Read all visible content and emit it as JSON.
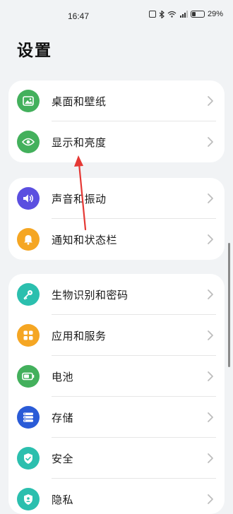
{
  "status_bar": {
    "time": "16:47",
    "battery": "29%"
  },
  "page": {
    "title": "设置"
  },
  "groups": [
    {
      "items": [
        {
          "label": "桌面和壁纸",
          "icon": "wallpaper-icon",
          "color": "#43b05c"
        },
        {
          "label": "显示和亮度",
          "icon": "eye-icon",
          "color": "#43b05c"
        }
      ]
    },
    {
      "items": [
        {
          "label": "声音和振动",
          "icon": "speaker-icon",
          "color": "#5b4fe0"
        },
        {
          "label": "通知和状态栏",
          "icon": "bell-icon",
          "color": "#f5a623"
        }
      ]
    },
    {
      "items": [
        {
          "label": "生物识别和密码",
          "icon": "key-icon",
          "color": "#2bbfae"
        },
        {
          "label": "应用和服务",
          "icon": "apps-icon",
          "color": "#f5a623"
        },
        {
          "label": "电池",
          "icon": "battery-icon",
          "color": "#43b05c"
        },
        {
          "label": "存储",
          "icon": "storage-icon",
          "color": "#2a5bd7"
        },
        {
          "label": "安全",
          "icon": "shield-icon",
          "color": "#2bbfae"
        },
        {
          "label": "隐私",
          "icon": "privacy-icon",
          "color": "#2bbfae"
        }
      ]
    }
  ],
  "annotation": {
    "color": "#e53935"
  }
}
